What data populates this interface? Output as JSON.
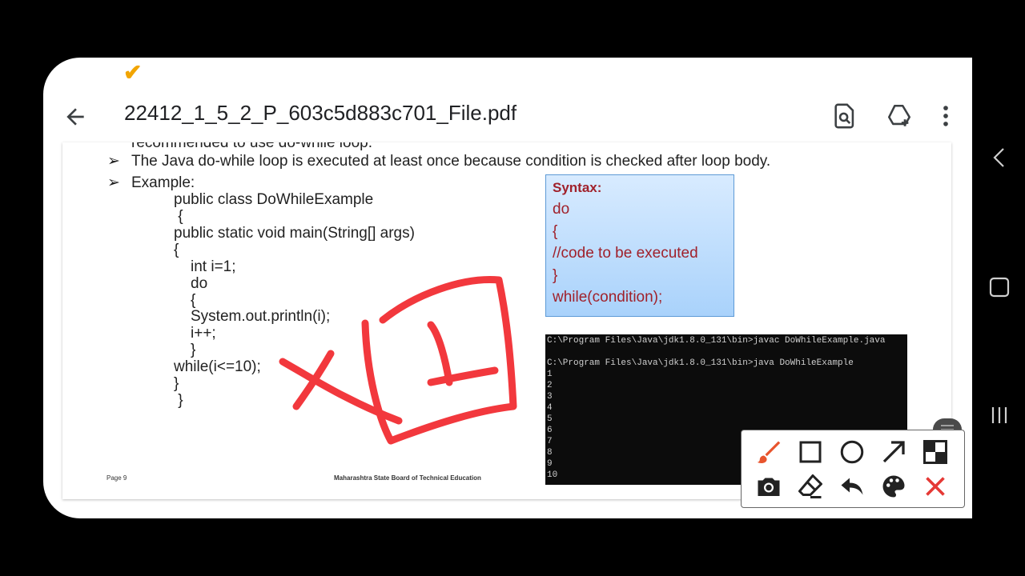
{
  "app": {
    "title": "22412_1_5_2_P_603c5d883c701_File.pdf"
  },
  "icons": {
    "back": "arrow-left-icon",
    "find": "search-document-icon",
    "drive": "add-to-drive-icon",
    "menu": "more-vert-icon",
    "check": "checkmark-icon"
  },
  "document": {
    "cutoff_line": "recommended to use do-while loop.",
    "bullet1": "The Java do-while loop is executed at least once because condition is checked after loop body.",
    "bullet2": "Example:",
    "code": [
      "public class DoWhileExample",
      " {",
      "public static void main(String[] args)",
      "{",
      "int i=1;",
      "do",
      "{",
      "System.out.println(i);",
      "i++;",
      "}",
      "while(i<=10);",
      "}",
      " }"
    ],
    "syntax": {
      "heading": "Syntax:",
      "lines": [
        "do",
        "{",
        "//code to be executed",
        "}",
        "while(condition);"
      ]
    },
    "terminal": {
      "cmd1": "C:\\Program Files\\Java\\jdk1.8.0_131\\bin>javac DoWhileExample.java",
      "cmd2": "C:\\Program Files\\Java\\jdk1.8.0_131\\bin>java DoWhileExample",
      "output": [
        "1",
        "2",
        "3",
        "4",
        "5",
        "6",
        "7",
        "8",
        "9",
        "10"
      ]
    },
    "footer_left": "Page 9",
    "footer_center": "Maharashtra State Board of Technical Education"
  },
  "annotation_toolbar": {
    "tools": [
      "brush-icon",
      "rectangle-icon",
      "circle-icon",
      "arrow-icon",
      "mosaic-icon",
      "camera-icon",
      "eraser-icon",
      "undo-icon",
      "palette-icon",
      "close-icon"
    ],
    "accent": "#e8542d",
    "close_color": "#e53935"
  },
  "colors": {
    "pen": "#f2383d",
    "syntax_text": "#a0212b"
  }
}
